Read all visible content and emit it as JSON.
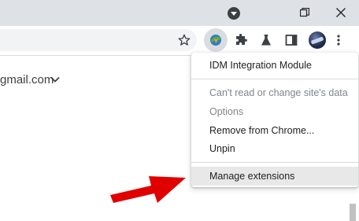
{
  "titlebar": {
    "icons": [
      "profile-dropdown-icon",
      "restore-icon",
      "close-icon"
    ]
  },
  "toolbar": {
    "icons": [
      "bookmark-star-icon",
      "idm-extension-icon",
      "puzzle-extensions-icon",
      "flask-labs-icon",
      "side-panel-icon",
      "profile-avatar",
      "more-menu-icon"
    ]
  },
  "page": {
    "account_text": "gmail.com"
  },
  "menu": {
    "title": "IDM Integration Module",
    "items": [
      {
        "label": "Can't read or change site's data",
        "disabled": true
      },
      {
        "label": "Options",
        "disabled": true
      },
      {
        "label": "Remove from Chrome...",
        "disabled": false
      },
      {
        "label": "Unpin",
        "disabled": false
      }
    ],
    "manage": "Manage extensions"
  },
  "colors": {
    "titlebar": "#dee1e6",
    "menu_highlight": "#e8e8e9",
    "arrow": "#e10000"
  }
}
